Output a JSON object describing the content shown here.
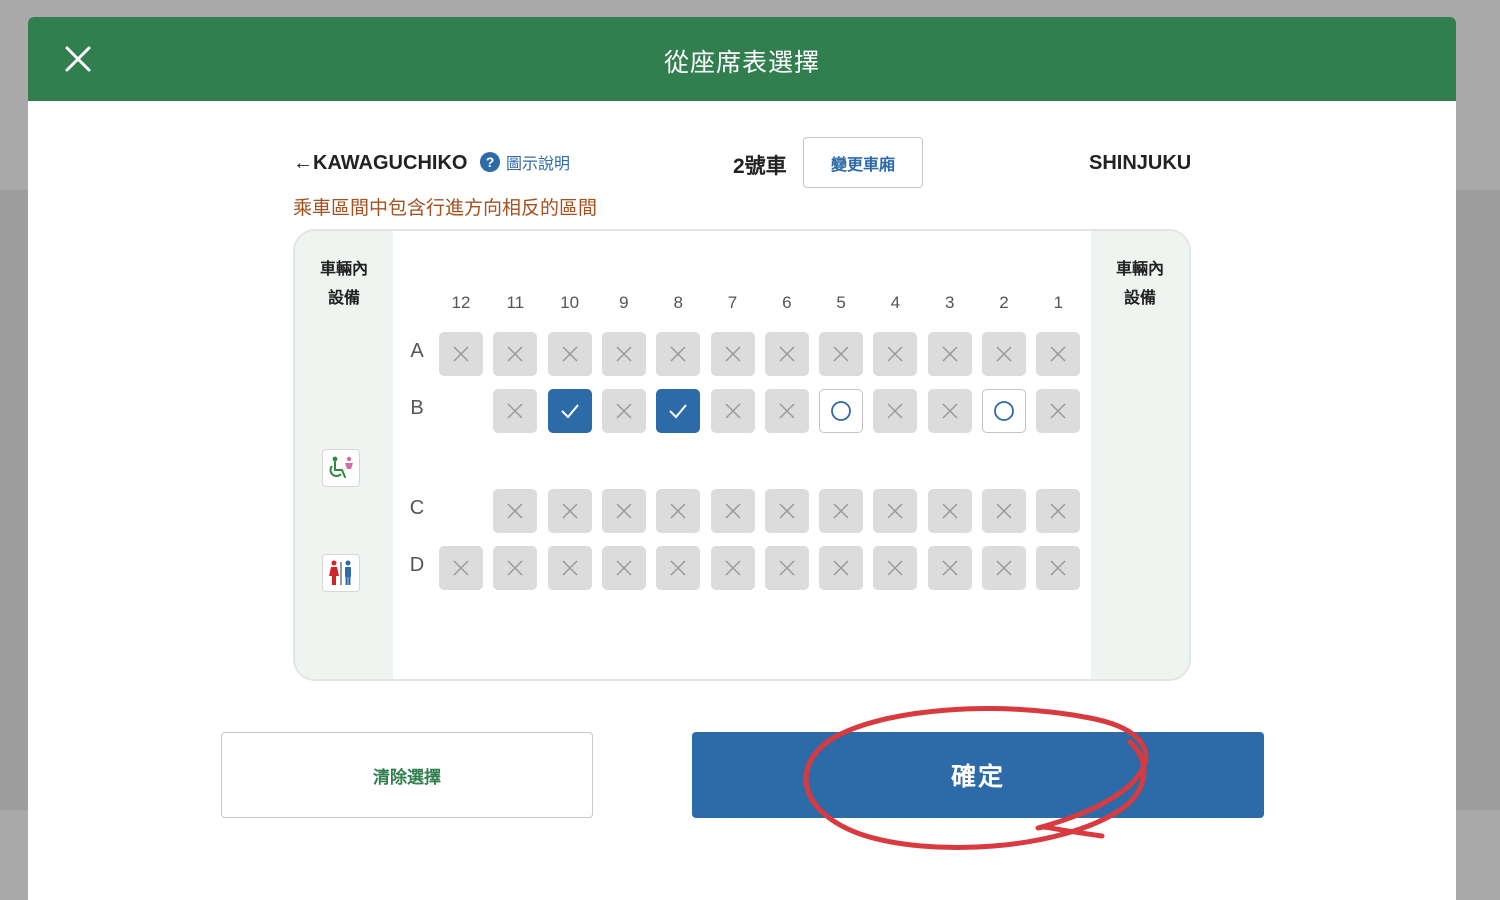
{
  "header": {
    "title": "從座席表選擇",
    "close_icon": "close-icon",
    "background_color": "#317f4f"
  },
  "route": {
    "from_label": "←KAWAGUCHIKO",
    "help_icon_glyph": "?",
    "help_label": "圖示說明",
    "car_label": "2號車",
    "change_car_label": "變更車廂",
    "to_label": "SHINJUKU"
  },
  "warning": "乘車區間中包含行進方向相反的區間",
  "seatmap": {
    "left_facility_title": "車輛內\n設備",
    "right_facility_title": "車輛內\n設備",
    "facility_icons": [
      "wheelchair-icon",
      "restroom-icon"
    ],
    "columns": [
      "12",
      "11",
      "10",
      "9",
      "8",
      "7",
      "6",
      "5",
      "4",
      "3",
      "2",
      "1"
    ],
    "rows": [
      {
        "letter": "A",
        "seats": [
          "x",
          "x",
          "x",
          "x",
          "x",
          "x",
          "x",
          "x",
          "x",
          "x",
          "x",
          "x"
        ]
      },
      {
        "letter": "B",
        "seats": [
          null,
          "x",
          "sel",
          "x",
          "sel",
          "x",
          "x",
          "o",
          "x",
          "x",
          "o",
          "x"
        ]
      },
      {
        "letter": "C",
        "seats": [
          null,
          "x",
          "x",
          "x",
          "x",
          "x",
          "x",
          "x",
          "x",
          "x",
          "x",
          "x"
        ]
      },
      {
        "letter": "D",
        "seats": [
          "x",
          "x",
          "x",
          "x",
          "x",
          "x",
          "x",
          "x",
          "x",
          "x",
          "x",
          "x"
        ]
      }
    ],
    "legend": {
      "x": "unavailable",
      "o": "available",
      "sel": "selected"
    },
    "colors": {
      "selected": "#2d6aa8",
      "unavailable": "#dcdcdc",
      "available": "#ffffff"
    }
  },
  "actions": {
    "clear_label": "清除選擇",
    "confirm_label": "確定"
  },
  "annotation": {
    "shape": "hand-drawn ellipse",
    "color": "#d83a3f",
    "target": "confirm button"
  }
}
